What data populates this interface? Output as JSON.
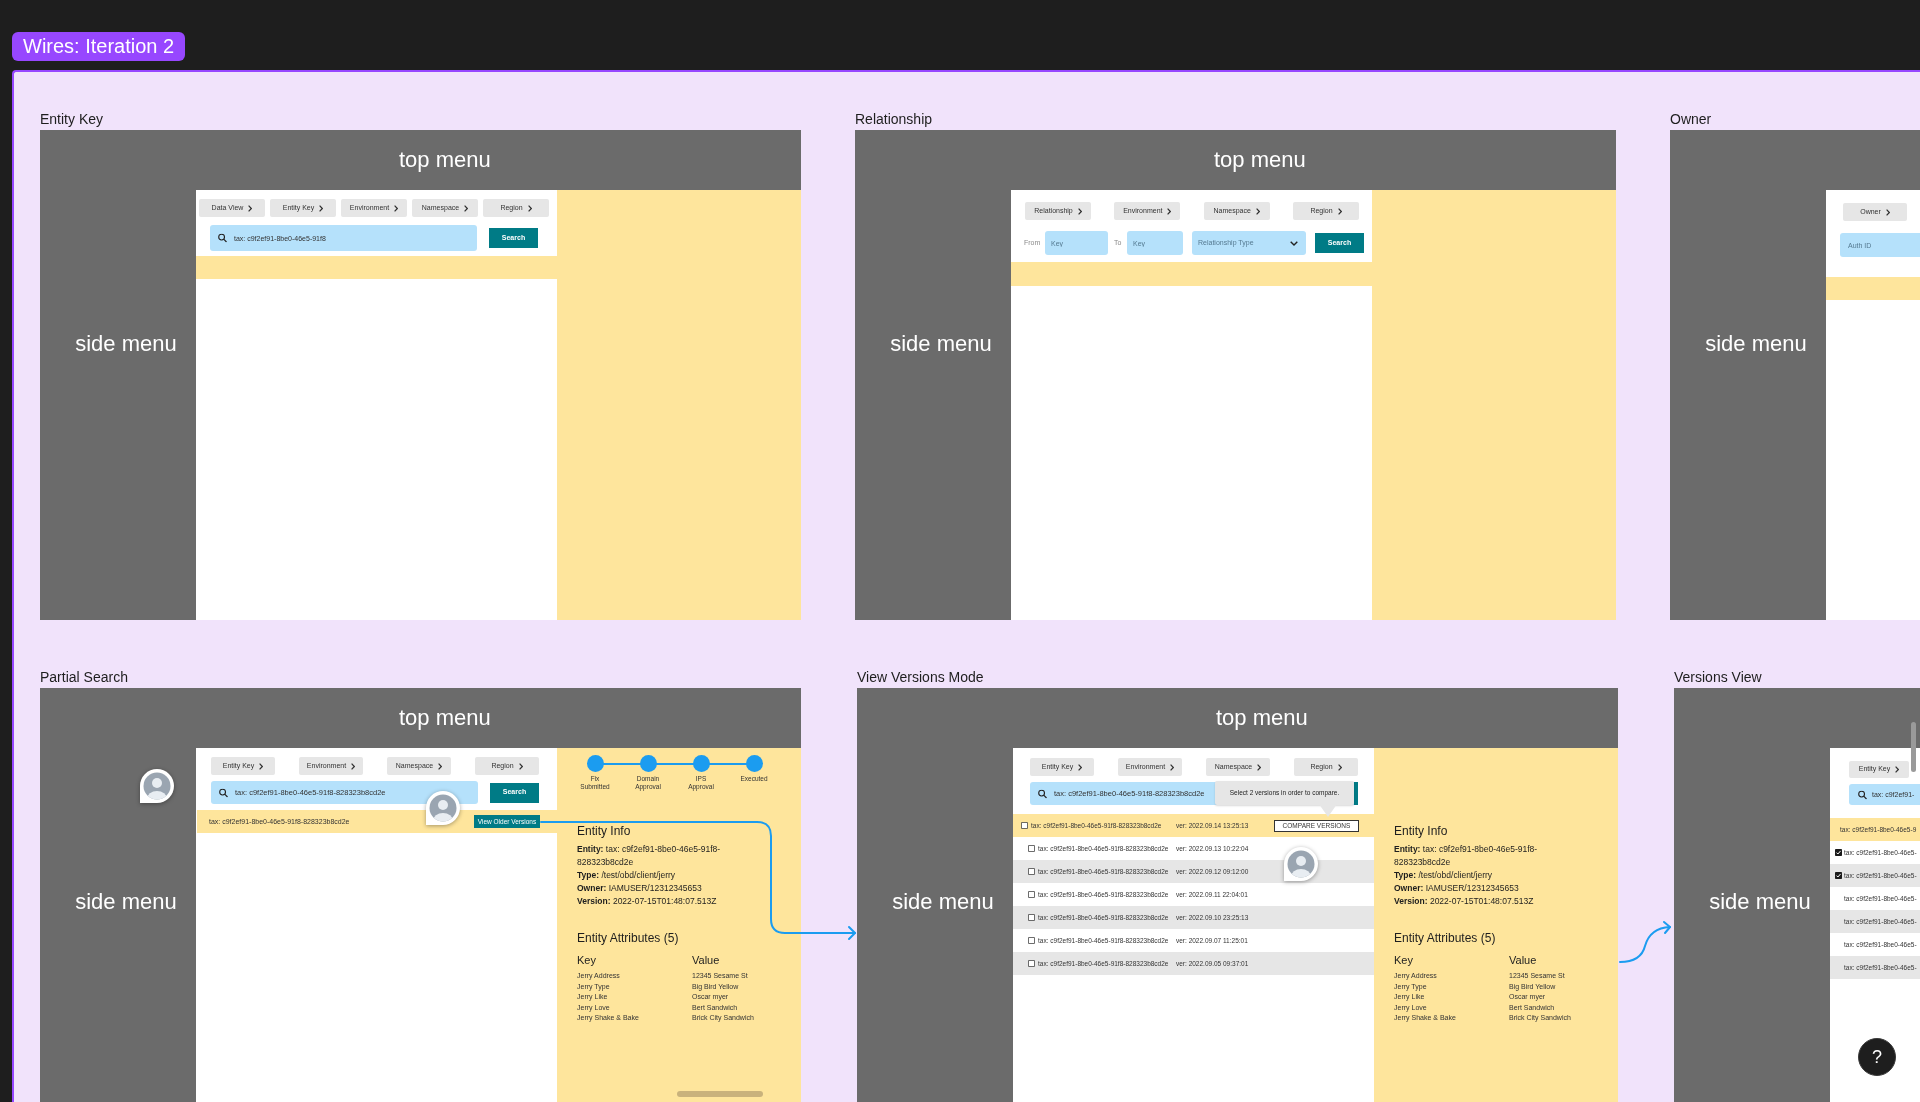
{
  "canvas": {
    "section_title": "Wires: Iteration 2",
    "help_button": "?"
  },
  "frames": [
    {
      "kind": "entity_key",
      "title": "Entity Key",
      "top_menu": "top menu",
      "side_menu": "side menu",
      "chips": [
        "Data View",
        "Entity Key",
        "Environment",
        "Namespace",
        "Region"
      ],
      "search": {
        "value": "tax: c9f2ef91-8be0-46e5-91f8",
        "button": "Search"
      }
    },
    {
      "kind": "relationship",
      "title": "Relationship",
      "top_menu": "top menu",
      "side_menu": "side menu",
      "chips": [
        "Relationship",
        "Environment",
        "Namespace",
        "Region"
      ],
      "from": {
        "label": "From",
        "placeholder": "Key"
      },
      "to": {
        "label": "To",
        "placeholder": "Key"
      },
      "type_select": {
        "placeholder": "Relationship Type"
      },
      "search_button": "Search"
    },
    {
      "kind": "owner",
      "title": "Owner",
      "side_menu": "side menu",
      "chips": [
        "Owner"
      ],
      "auth_id": {
        "placeholder": "Auth ID"
      }
    },
    {
      "kind": "partial_search",
      "title": "Partial Search",
      "top_menu": "top menu",
      "side_menu": "side menu",
      "chips": [
        "Entity Key",
        "Environment",
        "Namespace",
        "Region"
      ],
      "search": {
        "value": "tax: c9f2ef91-8be0-46e5-91f8-828323b8cd2e",
        "button": "Search"
      },
      "results": [
        {
          "text": "tax: c9f2ef91-8be0-46e5-91f8-828323b8cd2e",
          "button": "View Older Versions",
          "selected": true
        }
      ],
      "steps": [
        "Fix Submitted",
        "Domain Approval",
        "IPS Approval",
        "Executed"
      ],
      "entity_info": {
        "heading": "Entity Info",
        "lines": [
          "**Entity:** tax: c9f2ef91-8be0-46e5-91f8-828323b8cd2e",
          "**Type:** /test/obd/client/jerry",
          "**Owner:** IAMUSER/12312345653",
          "**Version:** 2022-07-15T01:48:07.513Z"
        ]
      },
      "attributes": {
        "heading": "Entity Attributes (5)",
        "columns": [
          "Key",
          "Value"
        ],
        "rows": [
          [
            "Jerry Address",
            "12345 Sesame St"
          ],
          [
            "Jerry Type",
            "Big Bird Yellow"
          ],
          [
            "Jerry Like",
            "Oscar myer"
          ],
          [
            "Jerry Love",
            "Bert Sandwich"
          ],
          [
            "Jerry Shake & Bake",
            "Brick City Sandwich"
          ]
        ]
      }
    },
    {
      "kind": "versions_mode",
      "title": "View Versions Mode",
      "top_menu": "top menu",
      "side_menu": "side menu",
      "chips": [
        "Entity Key",
        "Environment",
        "Namespace",
        "Region"
      ],
      "search": {
        "value": "tax: c9f2ef91-8be0-46e5-91f8-828323b8cd2e"
      },
      "tooltip": "Select 2 versions in order to compare.",
      "rows": [
        {
          "kind": "checkbox",
          "checked": false,
          "selected": true,
          "text": "tax: c9f2ef91-8be0-46e5-91f8-828323b8cd2e",
          "version": "ver: 2022.09.14 13:25:13",
          "button": "COMPARE VERSIONS"
        },
        {
          "kind": "checkbox",
          "checked": false,
          "selected": false,
          "text": "tax: c9f2ef91-8be0-46e5-91f8-828323b8cd2e",
          "version": "ver: 2022.09.13 10:22:04"
        },
        {
          "kind": "checkbox",
          "checked": false,
          "selected": false,
          "text": "tax: c9f2ef91-8be0-46e5-91f8-828323b8cd2e",
          "version": "ver: 2022.09.12 09:12:00"
        },
        {
          "kind": "checkbox",
          "checked": false,
          "selected": false,
          "text": "tax: c9f2ef91-8be0-46e5-91f8-828323b8cd2e",
          "version": "ver: 2022.09.11 22:04:01"
        },
        {
          "kind": "checkbox",
          "checked": false,
          "selected": false,
          "text": "tax: c9f2ef91-8be0-46e5-91f8-828323b8cd2e",
          "version": "ver: 2022.09.10 23:25:13"
        },
        {
          "kind": "checkbox",
          "checked": false,
          "selected": false,
          "text": "tax: c9f2ef91-8be0-46e5-91f8-828323b8cd2e",
          "version": "ver: 2022.09.07 11:25:01"
        },
        {
          "kind": "checkbox",
          "checked": false,
          "selected": false,
          "text": "tax: c9f2ef91-8be0-46e5-91f8-828323b8cd2e",
          "version": "ver: 2022.09.05 09:37:01"
        }
      ],
      "entity_info": {
        "heading": "Entity Info",
        "lines": [
          "**Entity:** tax: c9f2ef91-8be0-46e5-91f8-828323b8cd2e",
          "**Type:** /test/obd/client/jerry",
          "**Owner:** IAMUSER/12312345653",
          "**Version:** 2022-07-15T01:48:07.513Z"
        ]
      },
      "attributes": {
        "heading": "Entity Attributes (5)",
        "columns": [
          "Key",
          "Value"
        ],
        "rows": [
          [
            "Jerry Address",
            "12345 Sesame St"
          ],
          [
            "Jerry Type",
            "Big Bird Yellow"
          ],
          [
            "Jerry Like",
            "Oscar myer"
          ],
          [
            "Jerry Love",
            "Bert Sandwich"
          ],
          [
            "Jerry Shake & Bake",
            "Brick City Sandwich"
          ]
        ]
      }
    },
    {
      "kind": "versions_view",
      "title": "Versions View",
      "side_menu": "side menu",
      "chips": [
        "Entity Key"
      ],
      "search": {
        "value": "tax: c9f2ef91-"
      },
      "rows": [
        {
          "kind": "plain",
          "selected": true,
          "text": "tax: c9f2ef91-8be0-46e5-9"
        },
        {
          "kind": "checkbox",
          "checked": true,
          "selected": false,
          "text": "tax: c9f2ef91-8be0-46e5-"
        },
        {
          "kind": "checkbox",
          "checked": true,
          "selected": false,
          "text": "tax: c9f2ef91-8be0-46e5-"
        },
        {
          "kind": "plain",
          "selected": false,
          "text": "tax: c9f2ef91-8be0-46e5-"
        },
        {
          "kind": "plain",
          "selected": false,
          "text": "tax: c9f2ef91-8be0-46e5-"
        },
        {
          "kind": "plain",
          "selected": false,
          "text": "tax: c9f2ef91-8be0-46e5-"
        },
        {
          "kind": "plain",
          "selected": false,
          "text": "tax: c9f2ef91-8be0-46e5-"
        }
      ]
    }
  ]
}
